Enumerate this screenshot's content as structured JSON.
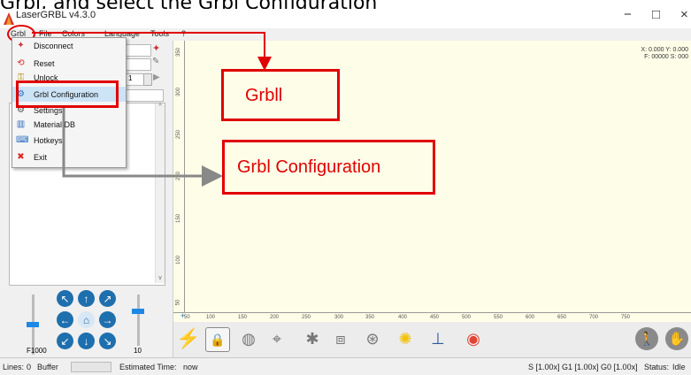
{
  "caption": "Grbl, and select the Grbl Configuration",
  "window": {
    "title": "LaserGRBL v4.3.0",
    "minimize": "−",
    "maximize": "□",
    "close": "×"
  },
  "menubar": [
    "Grbl",
    "File",
    "Colors",
    "Language",
    "Tools",
    "?"
  ],
  "grbl_menu": [
    {
      "label": "Disconnect",
      "icon": "disconnect-icon"
    },
    {
      "label": "Reset",
      "icon": "reset-icon"
    },
    {
      "label": "Unlock",
      "icon": "unlock-icon"
    },
    {
      "label": "Grbl Configuration",
      "icon": "config-icon"
    },
    {
      "label": "Settings",
      "icon": "settings-icon"
    },
    {
      "label": "Material DB",
      "icon": "book-icon"
    },
    {
      "label": "Hotkeys",
      "icon": "keyboard-icon"
    },
    {
      "label": "Exit",
      "icon": "exit-icon"
    }
  ],
  "callouts": {
    "grbl": "Grbll",
    "config": "Grbl Configuration"
  },
  "coords": {
    "xy": "X: 0.000 Y: 0.000",
    "fs": "F: 00000 S: 000"
  },
  "jog": {
    "spin_value": "1",
    "speed_label": "F1000",
    "step_label": "10"
  },
  "ruler_v": [
    "350",
    "300",
    "250",
    "200",
    "150",
    "100",
    "50"
  ],
  "ruler_h": [
    "50",
    "100",
    "150",
    "200",
    "250",
    "300",
    "350",
    "400",
    "450",
    "500",
    "550",
    "600",
    "650",
    "700",
    "750"
  ],
  "status": {
    "lines_label": "Lines:",
    "lines_value": "0",
    "buffer_label": "Buffer",
    "time_label": "Estimated Time:",
    "time_value": "now",
    "overrides": "S [1.00x] G1 [1.00x] G0 [1.00x]",
    "status_label": "Status:",
    "status_value": "Idle"
  },
  "colors": {
    "accent": "#e00000",
    "canvas": "#fefee8",
    "jog": "#1e6fae"
  }
}
